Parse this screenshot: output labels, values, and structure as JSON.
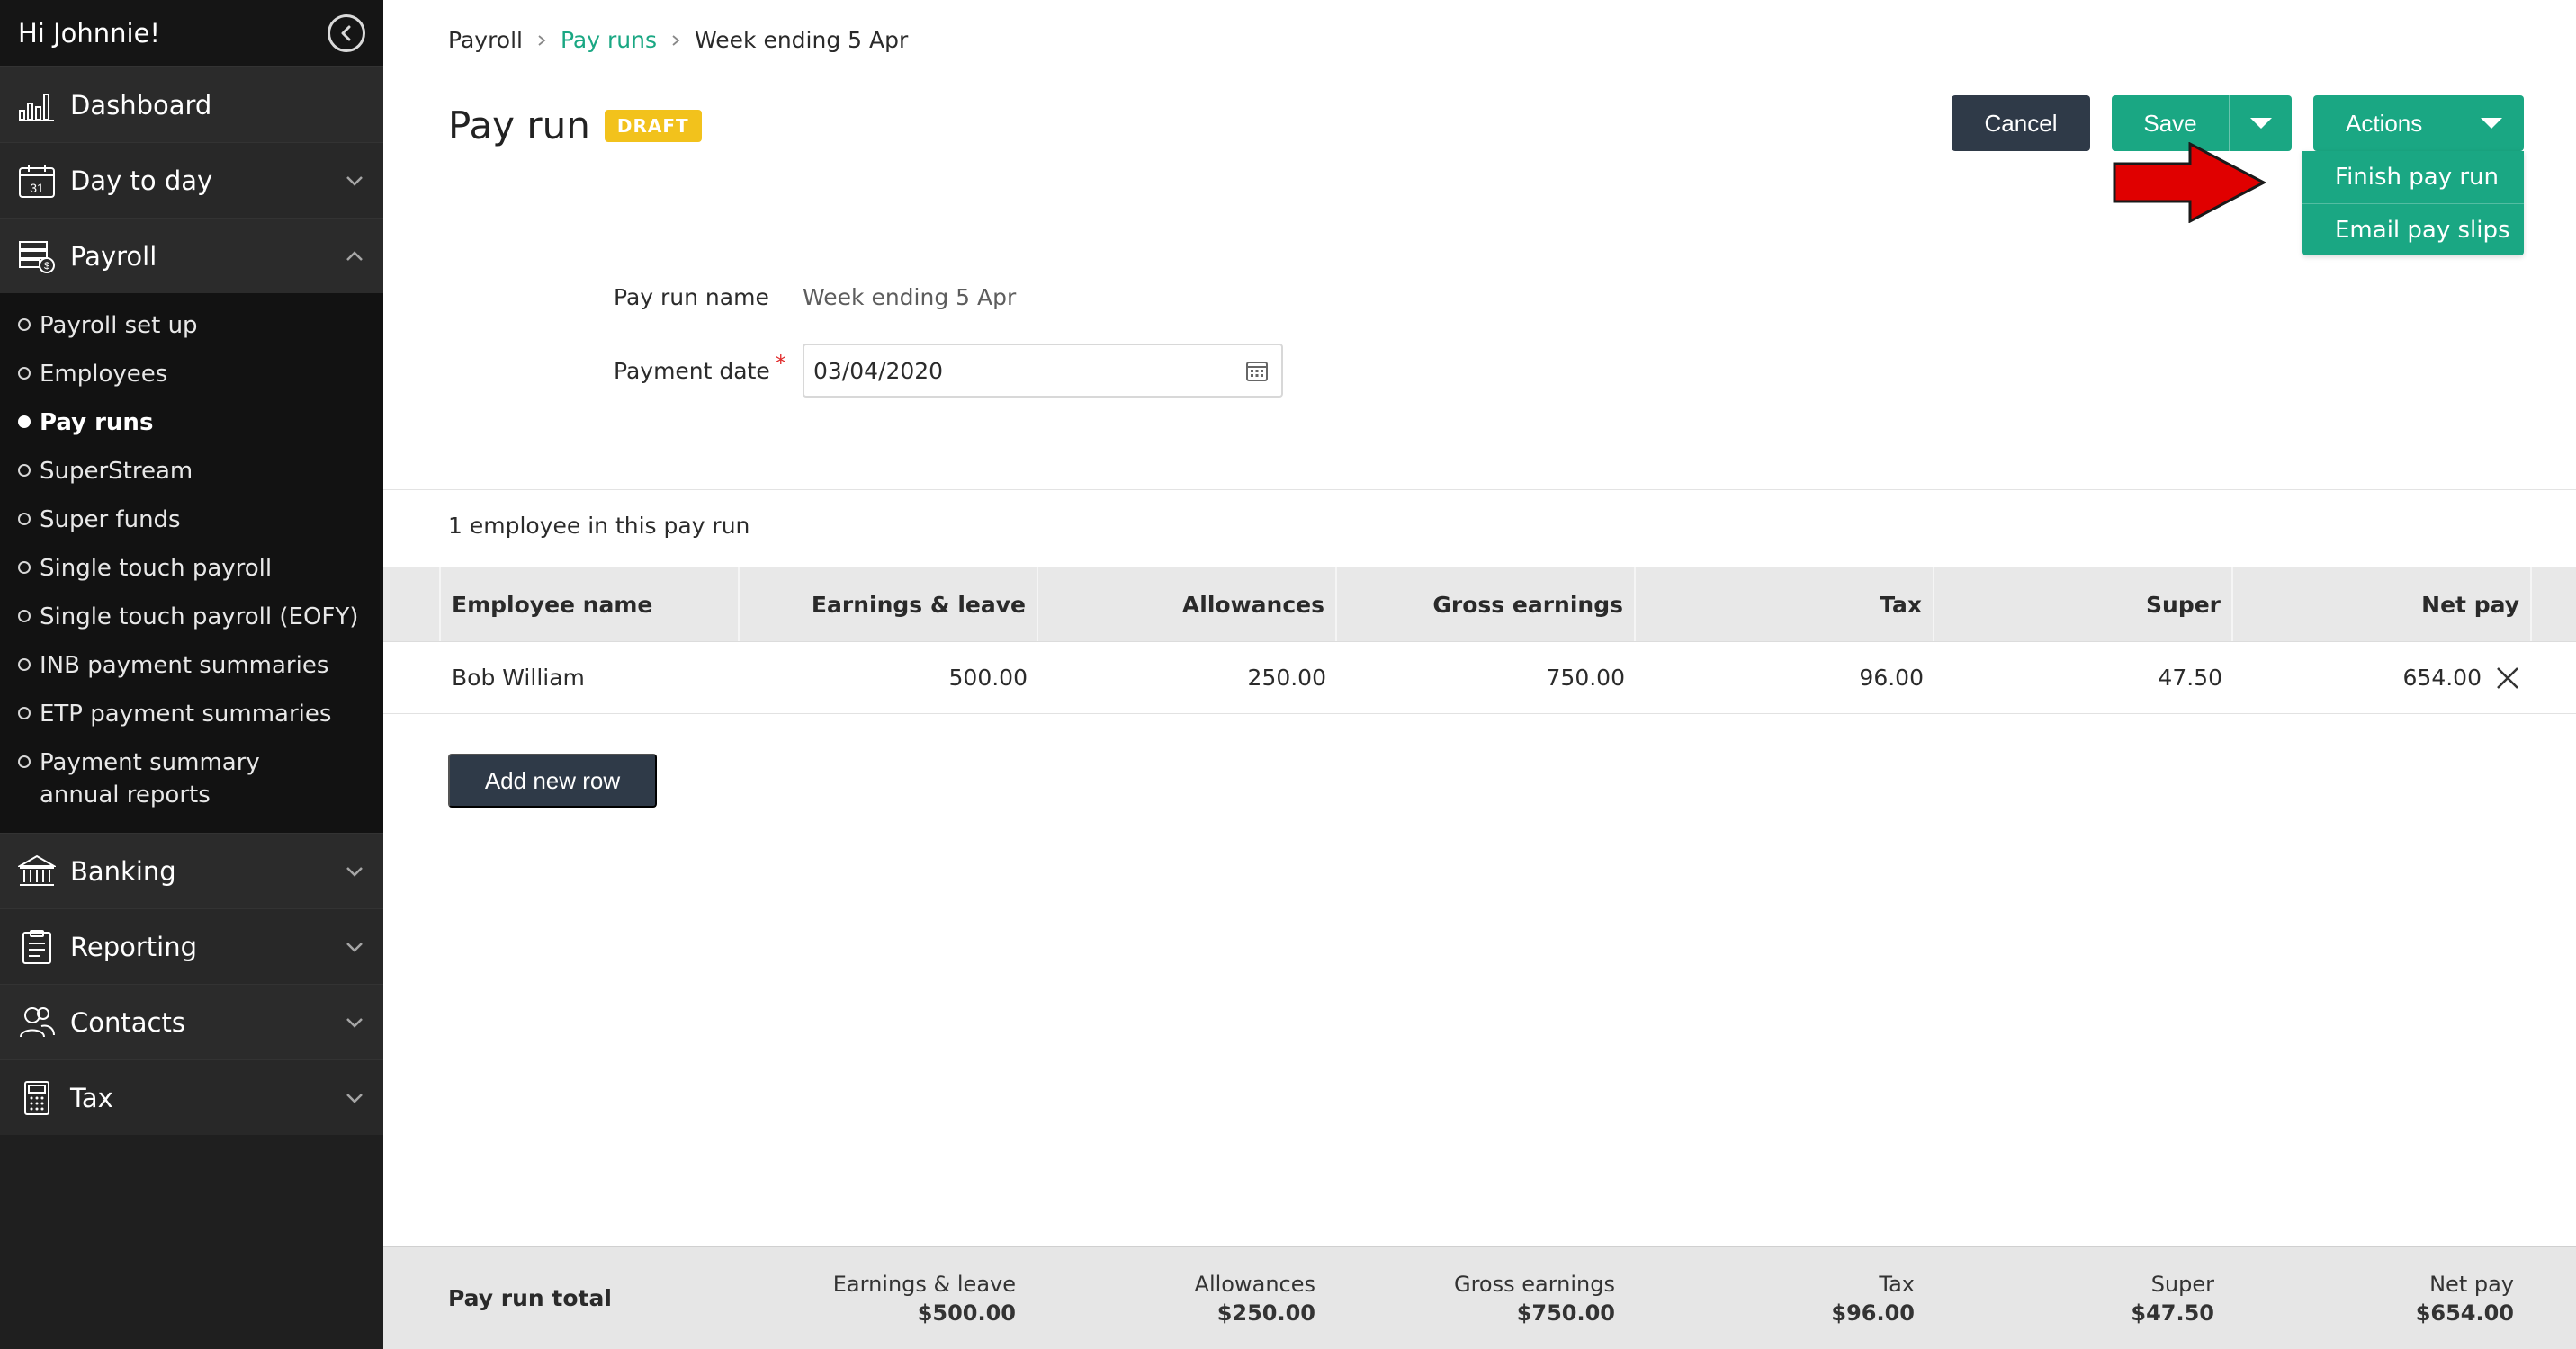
{
  "sidebar": {
    "greeting": "Hi Johnnie!",
    "items": [
      {
        "label": "Dashboard",
        "icon": "bar-chart-icon"
      },
      {
        "label": "Day to day",
        "icon": "calendar-icon"
      },
      {
        "label": "Payroll",
        "icon": "payroll-icon",
        "expanded": true
      },
      {
        "label": "Banking",
        "icon": "bank-icon"
      },
      {
        "label": "Reporting",
        "icon": "report-icon"
      },
      {
        "label": "Contacts",
        "icon": "contacts-icon"
      },
      {
        "label": "Tax",
        "icon": "calculator-icon"
      }
    ],
    "payroll_sub": [
      {
        "label": "Payroll set up"
      },
      {
        "label": "Employees"
      },
      {
        "label": "Pay runs",
        "active": true
      },
      {
        "label": "SuperStream"
      },
      {
        "label": "Super funds"
      },
      {
        "label": "Single touch payroll"
      },
      {
        "label": "Single touch payroll (EOFY)"
      },
      {
        "label": "INB payment summaries"
      },
      {
        "label": "ETP payment summaries"
      },
      {
        "label": "Payment summary annual reports"
      }
    ],
    "calendar_day": "31"
  },
  "breadcrumbs": {
    "payroll": "Payroll",
    "pay_runs": "Pay runs",
    "current": "Week ending 5 Apr"
  },
  "page": {
    "title": "Pay run",
    "badge": "DRAFT"
  },
  "actions": {
    "cancel": "Cancel",
    "save": "Save",
    "actions": "Actions",
    "dropdown": [
      "Finish pay run",
      "Email pay slips"
    ]
  },
  "form": {
    "pay_run_name_label": "Pay run name",
    "pay_run_name_value": "Week ending 5 Apr",
    "payment_date_label": "Payment date",
    "required_mark": "*",
    "payment_date_value": "03/04/2020"
  },
  "employees_count": "1 employee in this pay run",
  "table": {
    "headers": [
      "Employee name",
      "Earnings & leave",
      "Allowances",
      "Gross earnings",
      "Tax",
      "Super",
      "Net pay"
    ],
    "rows": [
      [
        "Bob William",
        "500.00",
        "250.00",
        "750.00",
        "96.00",
        "47.50",
        "654.00"
      ]
    ]
  },
  "add_row": "Add new row",
  "footer": {
    "label": "Pay run total",
    "totals": [
      {
        "label": "Earnings & leave",
        "value": "$500.00"
      },
      {
        "label": "Allowances",
        "value": "$250.00"
      },
      {
        "label": "Gross earnings",
        "value": "$750.00"
      },
      {
        "label": "Tax",
        "value": "$96.00"
      },
      {
        "label": "Super",
        "value": "$47.50"
      },
      {
        "label": "Net pay",
        "value": "$654.00"
      }
    ]
  },
  "colors": {
    "accent": "#1aa783",
    "draft_badge": "#f2c21c",
    "dark_button": "#2f3a48",
    "annotation_arrow": "#e00000"
  }
}
